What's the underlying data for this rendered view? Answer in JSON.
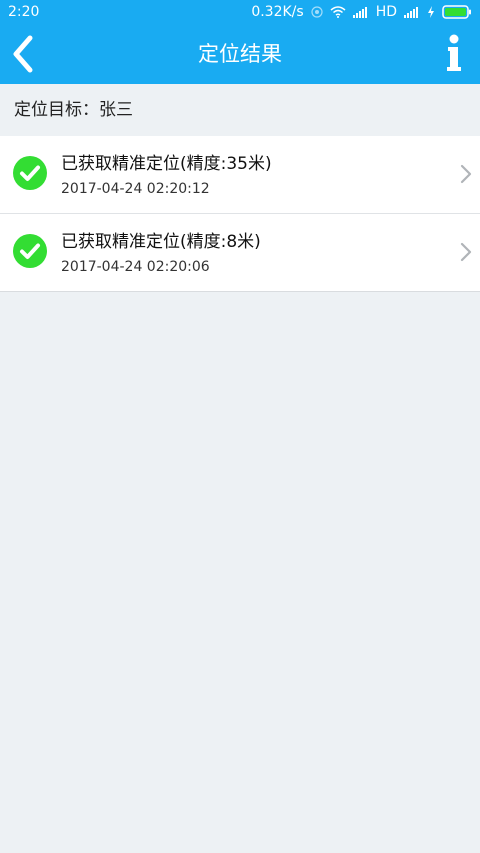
{
  "status_bar": {
    "time": "2:20",
    "net_speed": "0.32K/s",
    "hd_label": "HD"
  },
  "header": {
    "title": "定位结果"
  },
  "target": {
    "label": "定位目标：张三"
  },
  "results": [
    {
      "text": "已获取精准定位(精度:35米)",
      "time": "2017-04-24 02:20:12"
    },
    {
      "text": "已获取精准定位(精度:8米)",
      "time": "2017-04-24 02:20:06"
    }
  ],
  "colors": {
    "accent": "#19abf2",
    "success": "#33dd33",
    "background": "#edf1f4"
  },
  "icons": [
    "back-arrow-icon",
    "info-icon",
    "check-circle-icon",
    "chevron-right-icon"
  ]
}
